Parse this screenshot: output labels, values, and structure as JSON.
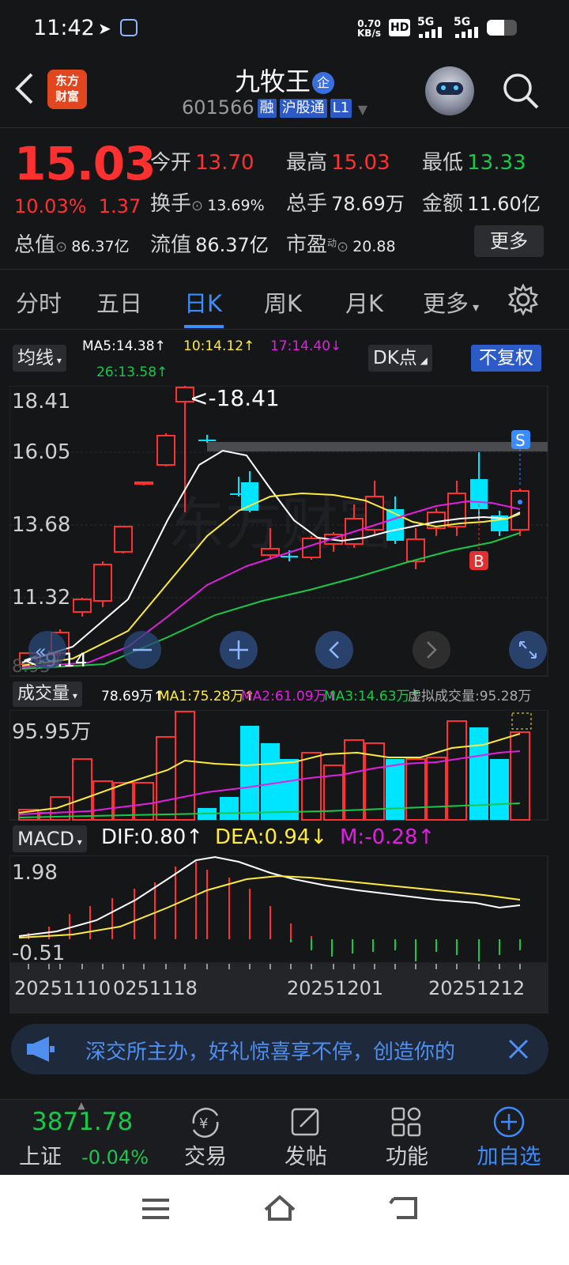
{
  "status_bar": {
    "time": "11:42",
    "net_speed_value": "0.70",
    "net_speed_unit": "KB/s",
    "hd_label": "HD",
    "signal1_label": "5G",
    "signal2_label": "5G"
  },
  "header": {
    "back_icon": "back-chevron",
    "logo_line1": "东方",
    "logo_line2": "财富",
    "stock_name": "九牧王",
    "enterprise_badge": "企",
    "stock_code": "601566",
    "tag_margin": "融",
    "tag_connect": "沪股通",
    "tag_level": "L1"
  },
  "quote": {
    "price": "15.03",
    "change_pct": "10.03%",
    "change_amt": "1.37",
    "open_label": "今开",
    "open_value": "13.70",
    "high_label": "最高",
    "high_value": "15.03",
    "low_label": "最低",
    "low_value": "13.33",
    "turnover_label": "换手",
    "turnover_value": "13.69%",
    "volume_label": "总手",
    "volume_value": "78.69万",
    "amount_label": "金额",
    "amount_value": "11.60亿",
    "mktcap_label": "总值",
    "mktcap_value": "86.37亿",
    "float_label": "流值",
    "float_value": "86.37亿",
    "pe_label": "市盈",
    "pe_sup": "动",
    "pe_value": "20.88",
    "more_button": "更多"
  },
  "tabs": [
    {
      "label": "分时"
    },
    {
      "label": "五日"
    },
    {
      "label": "日K"
    },
    {
      "label": "周K"
    },
    {
      "label": "月K"
    },
    {
      "label": "更多"
    }
  ],
  "kline": {
    "indicator_select": "均线",
    "ma5": "MA5:14.38↑",
    "ma10": "10:14.12↑",
    "ma17": "17:14.40↓",
    "ma26": "26:13.58↑",
    "dk_button": "DK点",
    "fuquan_button": "不复权",
    "y_ticks": [
      "18.41",
      "16.05",
      "13.68",
      "11.32"
    ],
    "high_marker": "<-18.41",
    "low_marker": "<-9.14",
    "low_tick": "8.95",
    "sell_marker": "S",
    "buy_marker": "B",
    "colors": {
      "up": "#ff3030",
      "down": "#00e5ff",
      "ma5": "#ffffff",
      "ma10": "#ffeb3b",
      "ma17": "#e020e0",
      "ma26": "#19c84a"
    }
  },
  "volume": {
    "indicator_select": "成交量",
    "current": "78.69万↑",
    "ma1": "MA1:75.28万↑",
    "ma2": "MA2:61.09万↑",
    "ma3": "MA3:14.63万↑",
    "virtual": "虚拟成交量:95.28万",
    "y_tick": "95.95万"
  },
  "macd": {
    "indicator_select": "MACD",
    "dif": "DIF:0.80↑",
    "dea": "DEA:0.94↓",
    "m": "M:-0.28↑",
    "y_top": "1.98",
    "y_bottom": "-0.51"
  },
  "dates": [
    "20251110",
    "0251118",
    "20251201",
    "20251212"
  ],
  "promo": {
    "text": "深交所主办，好礼惊喜享不停，创造你的"
  },
  "bottom_bar": {
    "index_value": "3871.78",
    "index_name": "上证",
    "index_change": "-0.04%",
    "trade": "交易",
    "post": "发帖",
    "functions": "功能",
    "add_watch": "加自选"
  },
  "watermark": "东方财富"
}
